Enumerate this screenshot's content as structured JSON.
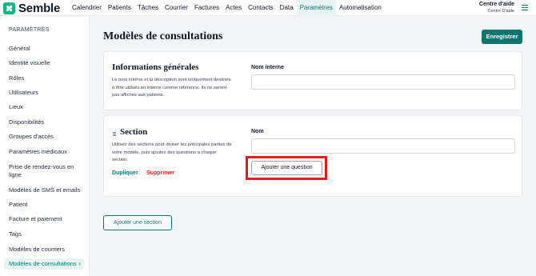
{
  "brand": {
    "name": "Semble",
    "logo_icon": "semble-logo-icon"
  },
  "nav": {
    "items": [
      "Calendrier",
      "Patients",
      "Tâches",
      "Courrier",
      "Factures",
      "Actes",
      "Contacts",
      "Data",
      "Paramètres",
      "Automatisation"
    ],
    "active": "Paramètres"
  },
  "help": {
    "title": "Centre d'aide",
    "subtitle": "Centre D'aide"
  },
  "sidebar": {
    "title": "PARAMÈTRES",
    "items": [
      {
        "label": "Général"
      },
      {
        "label": "Identité visuelle"
      },
      {
        "label": "Rôles"
      },
      {
        "label": "Utilisateurs"
      },
      {
        "label": "Lieux"
      },
      {
        "label": "Disponibilités"
      },
      {
        "label": "Groupes d'accès"
      },
      {
        "label": "Paramètres médicaux"
      },
      {
        "label": "Prise de rendez-vous en ligne"
      },
      {
        "label": "Modèles de SMS et emails"
      },
      {
        "label": "Patient"
      },
      {
        "label": "Facture et paiement"
      },
      {
        "label": "Tags"
      },
      {
        "label": "Modèles de courriers"
      },
      {
        "label": "Modèles de consultations"
      }
    ],
    "active": "Modèles de consultations"
  },
  "main": {
    "title": "Modèles de consultations",
    "save_label": "Enregistrer",
    "general": {
      "title": "Informations générales",
      "description": "Le nom interne et la description sont uniquement destinés à être utilisés en interne comme référence. Ils ne seront pas affichés aux patients.",
      "field_label": "Nom interne",
      "field_value": ""
    },
    "section": {
      "title": "Section",
      "description": "Utilisez des sections pour diviser les principales parties de votre modèle, puis ajoutez des questions à chaque section.",
      "field_label": "Nom",
      "field_value": "",
      "duplicate_label": "Dupliquer",
      "delete_label": "Supprimer",
      "add_question_label": "Ajouter une question"
    },
    "add_section_label": "Ajouter une section"
  },
  "colors": {
    "accent": "#0f766e",
    "danger": "#dc2626",
    "highlight": "#e11d1d",
    "brand": "#10b981"
  }
}
